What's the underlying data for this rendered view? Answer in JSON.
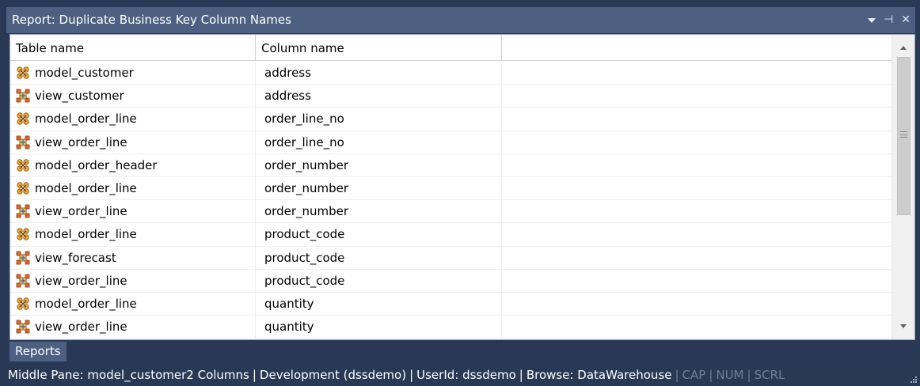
{
  "window": {
    "title": "Report: Duplicate Business Key Column Names",
    "controls": {
      "pin": "⊣",
      "close": "✕"
    }
  },
  "grid": {
    "columns": [
      "Table name",
      "Column name",
      ""
    ],
    "rows": [
      {
        "table": "model_customer",
        "column": "address",
        "icon": "model-table-icon"
      },
      {
        "table": "view_customer",
        "column": "address",
        "icon": "view-table-icon"
      },
      {
        "table": "model_order_line",
        "column": "order_line_no",
        "icon": "model-table-icon"
      },
      {
        "table": "view_order_line",
        "column": "order_line_no",
        "icon": "view-table-icon"
      },
      {
        "table": "model_order_header",
        "column": "order_number",
        "icon": "model-table-icon"
      },
      {
        "table": "model_order_line",
        "column": "order_number",
        "icon": "model-table-icon"
      },
      {
        "table": "view_order_line",
        "column": "order_number",
        "icon": "view-table-icon"
      },
      {
        "table": "model_order_line",
        "column": "product_code",
        "icon": "model-table-icon"
      },
      {
        "table": "view_forecast",
        "column": "product_code",
        "icon": "view-table-icon"
      },
      {
        "table": "view_order_line",
        "column": "product_code",
        "icon": "view-table-icon"
      },
      {
        "table": "model_order_line",
        "column": "quantity",
        "icon": "model-table-icon"
      },
      {
        "table": "view_order_line",
        "column": "quantity",
        "icon": "view-table-icon"
      }
    ]
  },
  "tabs": [
    {
      "label": "Reports"
    }
  ],
  "statusbar": {
    "pane": "Middle Pane: model_customer2 Columns",
    "connection": "Development (dssdemo)",
    "user": "UserId: dssdemo",
    "browse": "Browse: DataWarehouse",
    "cap": "CAP",
    "num": "NUM",
    "scrl": "SCRL"
  },
  "colors": {
    "frame": "#293955",
    "titlebar": "#4d6082",
    "model_icon": "#e39a2a",
    "view_icon": "#d9622b"
  }
}
